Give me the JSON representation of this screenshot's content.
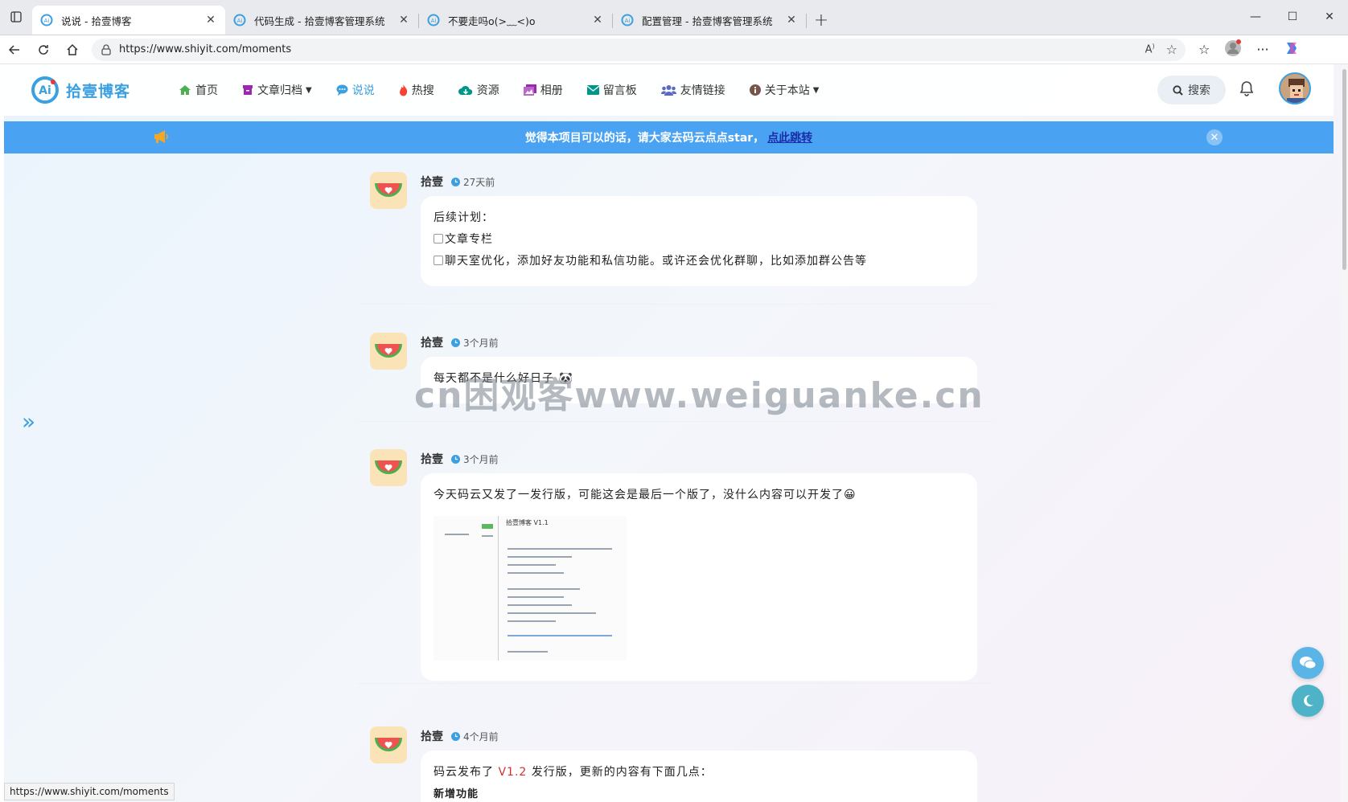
{
  "browser": {
    "tabs": [
      {
        "label": "说说 - 拾壹博客",
        "active": true
      },
      {
        "label": "代码生成 - 拾壹博客管理系统",
        "active": false
      },
      {
        "label": "不要走吗o(>﹏<)o",
        "active": false
      },
      {
        "label": "配置管理 - 拾壹博客管理系统",
        "active": false
      }
    ],
    "url": "https://www.shiyit.com/moments",
    "status_url": "https://www.shiyit.com/moments"
  },
  "site": {
    "logo_text": "拾壹博客",
    "nav": [
      {
        "label": "首页",
        "icon": "home-icon",
        "color": "#4caf50"
      },
      {
        "label": "文章归档",
        "icon": "archive-icon",
        "color": "#9c27b0",
        "dropdown": true
      },
      {
        "label": "说说",
        "icon": "chat-bubble-icon",
        "color": "#3b9fe0",
        "active": true
      },
      {
        "label": "热搜",
        "icon": "fire-icon",
        "color": "#f44336"
      },
      {
        "label": "资源",
        "icon": "cloud-download-icon",
        "color": "#009688"
      },
      {
        "label": "相册",
        "icon": "photo-icon",
        "color": "#9c27b0"
      },
      {
        "label": "留言板",
        "icon": "envelope-icon",
        "color": "#009688"
      },
      {
        "label": "友情链接",
        "icon": "users-icon",
        "color": "#5c6bc0"
      },
      {
        "label": "关于本站",
        "icon": "info-icon",
        "color": "#795548",
        "dropdown": true
      }
    ],
    "search_label": "搜索"
  },
  "announcement": {
    "text": "觉得本项目可以的话，请大家去码云点点star，",
    "link": "点此跳转"
  },
  "moments": [
    {
      "author": "拾壹",
      "time": "27天前",
      "lines": [
        "后续计划：",
        "文章专栏",
        "聊天室优化，添加好友功能和私信功能。或许还会优化群聊，比如添加群公告等"
      ]
    },
    {
      "author": "拾壹",
      "time": "3个月前",
      "text": "每天都不是什么好日子"
    },
    {
      "author": "拾壹",
      "time": "3个月前",
      "text": "今天码云又发了一发行版，可能这会是最后一个版了，没什么内容可以开发了😀",
      "image_title": "拾壹博客 V1.1"
    },
    {
      "author": "拾壹",
      "time": "4个月前",
      "text_prefix": "码云发布了 ",
      "version": "V1.2",
      "text_suffix": " 发行版，更新的内容有下面几点：",
      "subheading": "新增功能"
    }
  ],
  "watermark": "cn困观客www.weiguanke.cn",
  "colors": {
    "accent": "#3b9fe0",
    "banner": "#4aa3f2",
    "version_red": "#d0312d"
  }
}
